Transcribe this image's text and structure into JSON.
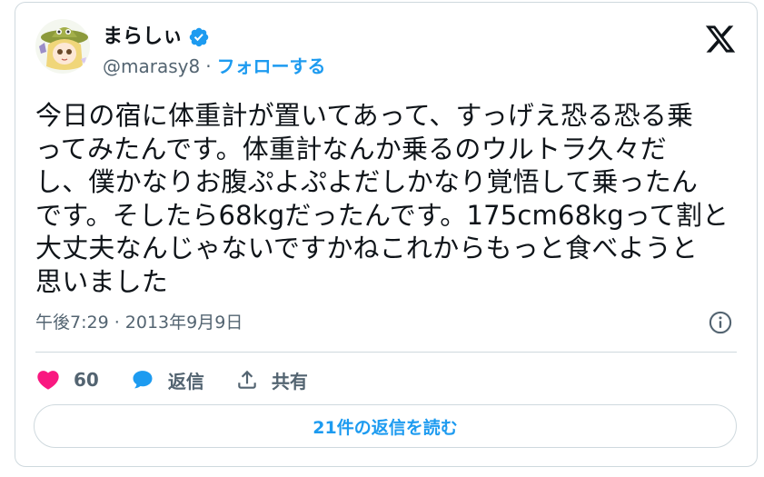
{
  "author": {
    "display_name": "まらしぃ",
    "handle": "@marasy8",
    "separator": "·",
    "follow_label": "フォローする",
    "verified": true
  },
  "tweet": {
    "text": "今日の宿に体重計が置いてあって、すっげえ恐る恐る乗\nってみたんです。体重計なんか乗るのウルトラ久々だ\nし、僕かなりお腹ぷよぷよだしかなり覚悟して乗ったん\nです。そしたら68kgだったんです。175cm68kgって割と\n大丈夫なんじゃないですかねこれからもっと食べようと\n思いました",
    "timestamp": "午後7:29 · 2013年9月9日"
  },
  "actions": {
    "like_count": "60",
    "reply_label": "返信",
    "share_label": "共有"
  },
  "footer": {
    "read_replies_label": "21件の返信を読む"
  },
  "colors": {
    "accent": "#1d9bf0",
    "like": "#f91880",
    "muted": "#536471",
    "border": "#cfd9de"
  },
  "icons": {
    "verified": "verified-badge-icon",
    "logo": "x-logo-icon",
    "info": "info-icon",
    "like": "heart-icon",
    "reply": "speech-bubble-icon",
    "share": "share-icon"
  }
}
